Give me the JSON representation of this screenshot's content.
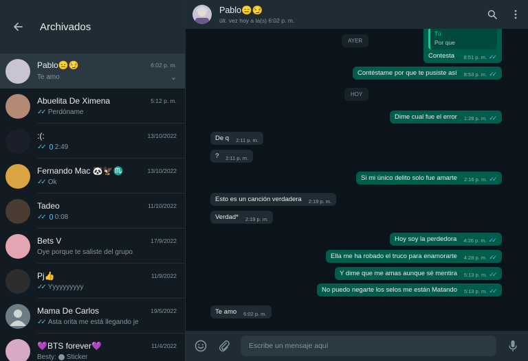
{
  "left": {
    "title": "Archivados",
    "chats": [
      {
        "name": "Pablo😑😏",
        "time": "6:02 p. m.",
        "preview": "Te amo",
        "tick": false,
        "mic": false,
        "active": true,
        "chevron": "⌄",
        "avatar_color": "#c9c4d4"
      },
      {
        "name": "Abuelita De Ximena",
        "time": "5:12 p. m.",
        "preview": "Perdóname",
        "tick": true,
        "mic": false,
        "active": false,
        "chevron": "",
        "avatar_color": "#b48a74"
      },
      {
        "name": ":(:",
        "time": "13/10/2022",
        "preview": "2:49",
        "tick": true,
        "mic": true,
        "active": false,
        "chevron": "",
        "avatar_color": "#1a1f2a"
      },
      {
        "name": "Fernando Mac 🐼🦅♏",
        "time": "13/10/2022",
        "preview": "Ok",
        "tick": true,
        "mic": false,
        "active": false,
        "chevron": "",
        "avatar_color": "#d9a441"
      },
      {
        "name": "Tadeo",
        "time": "11/10/2022",
        "preview": "0:08",
        "tick": true,
        "mic": true,
        "active": false,
        "chevron": "",
        "avatar_color": "#4a3b33"
      },
      {
        "name": "Bets V",
        "time": "17/9/2022",
        "preview": "Oye porque te saliste del grupo",
        "tick": false,
        "mic": false,
        "active": false,
        "chevron": "",
        "avatar_color": "#e3a6b1"
      },
      {
        "name": "Pj👍",
        "time": "11/9/2022",
        "preview": "Yyyyyyyyyy",
        "tick": true,
        "mic": false,
        "active": false,
        "chevron": "",
        "avatar_color": "#2d2d2d"
      },
      {
        "name": "Mama De Carlos",
        "time": "19/5/2022",
        "preview": "Asta orita me está llegando je",
        "tick": true,
        "mic": false,
        "active": false,
        "chevron": "",
        "avatar_color": "#6b7c85"
      },
      {
        "name": "💜BTS forever💜",
        "time": "11/4/2022",
        "preview": "Sticker",
        "sender": "Besty:",
        "sticker": true,
        "tick": false,
        "mic": false,
        "active": false,
        "chevron": "",
        "avatar_color": "#d7a9c4"
      }
    ]
  },
  "header": {
    "name": "Pablo😑😏",
    "status": "últ. vez hoy a la(s) 6:02 p. m."
  },
  "conversation": {
    "quote_sender": "Tú",
    "quote_text": "Por que",
    "messages": [
      {
        "kind": "out",
        "text": "Contesta",
        "time": "8:51 p. m."
      },
      {
        "kind": "chip",
        "text": "AYER"
      },
      {
        "kind": "out",
        "text": "Contéstame por que te pusiste así",
        "time": "8:53 p. m."
      },
      {
        "kind": "chip",
        "text": "HOY"
      },
      {
        "kind": "out",
        "text": "Dime cual fue el error",
        "time": "1:28 p. m."
      },
      {
        "kind": "in",
        "text": "De q",
        "time": "2:11 p. m."
      },
      {
        "kind": "in",
        "text": "?",
        "time": "2:11 p. m."
      },
      {
        "kind": "out",
        "text": "Si mi único delito solo fue amarte",
        "time": "2:16 p. m."
      },
      {
        "kind": "in",
        "text": "Esto es un canción verdadera",
        "time": "2:19 p. m."
      },
      {
        "kind": "in",
        "text": "Verdad*",
        "time": "2:19 p. m."
      },
      {
        "kind": "out",
        "text": "Hoy soy la perdedora",
        "time": "4:26 p. m."
      },
      {
        "kind": "out",
        "text": "Ella me ha robado el truco para enamorarte",
        "time": "4:28 p. m."
      },
      {
        "kind": "out",
        "text": "Y dime que me amas aunque sé mentira",
        "time": "5:13 p. m."
      },
      {
        "kind": "out",
        "text": "No puedo negarte los selos me están Matando",
        "time": "5:13 p. m."
      },
      {
        "kind": "in",
        "text": "Te amo",
        "time": "6:02 p. m."
      }
    ]
  },
  "composer": {
    "placeholder": "Escribe un mensaje aquí"
  },
  "colors": {
    "outgoing_bubble": "#005c4b",
    "incoming_bubble": "#202c33",
    "read_tick": "#53bdeb",
    "accent": "#00a884"
  }
}
